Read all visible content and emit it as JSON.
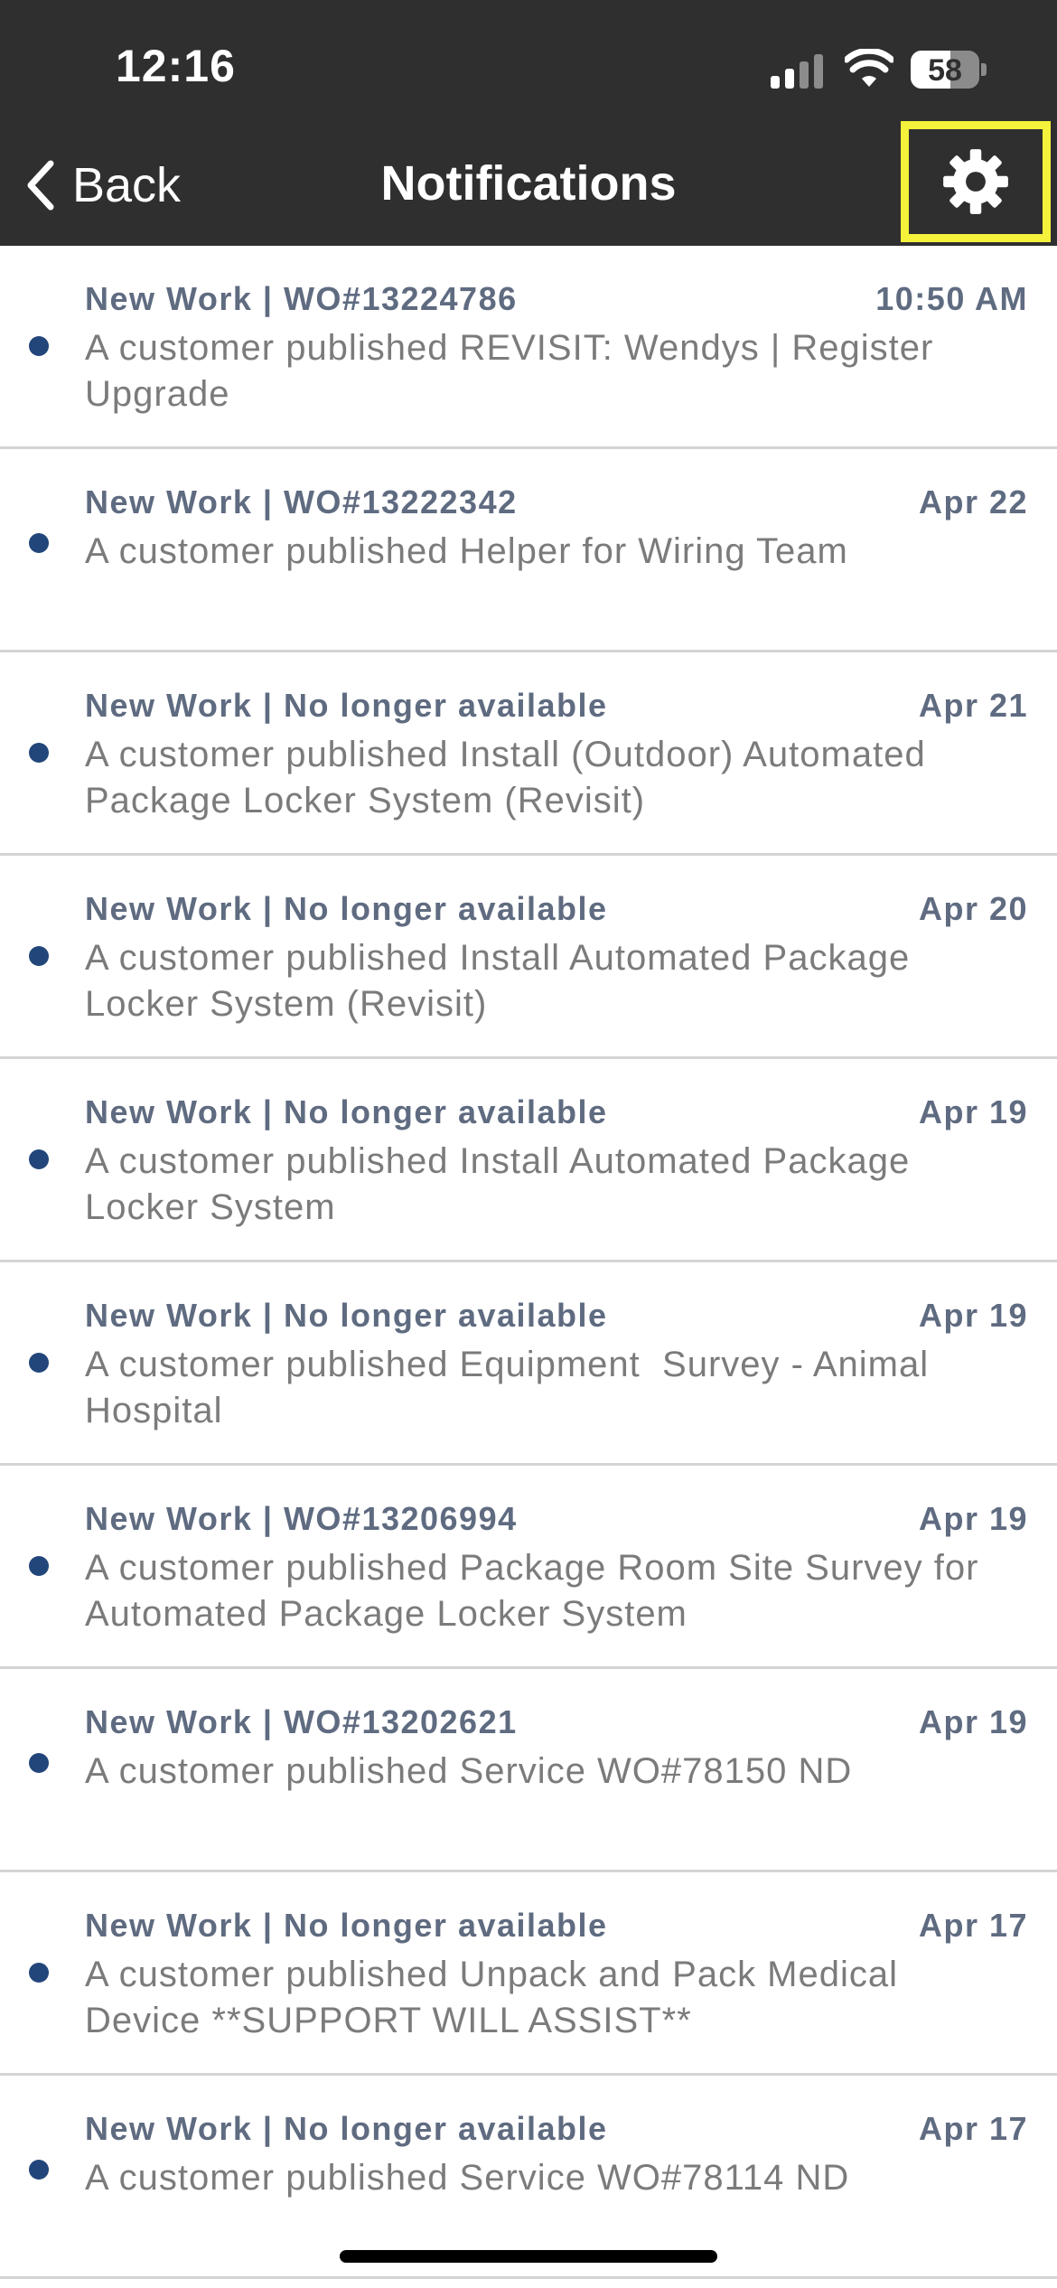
{
  "status_bar": {
    "time": "12:16",
    "battery_percent": "58",
    "battery_level": 0.58
  },
  "nav": {
    "back_label": "Back",
    "title": "Notifications",
    "settings_icon": "gear-icon",
    "highlight_color": "#f4f23a"
  },
  "notifications": [
    {
      "header": "New Work | WO#13224786",
      "time": "10:50 AM",
      "text": "A customer published REVISIT: Wendys | Register Upgrade"
    },
    {
      "header": "New Work | WO#13222342",
      "time": "Apr 22",
      "text": "A customer published Helper for Wiring Team"
    },
    {
      "header": "New Work | No longer available",
      "time": "Apr 21",
      "text": "A customer published Install (Outdoor) Automated Package Locker System (Revisit)"
    },
    {
      "header": "New Work | No longer available",
      "time": "Apr 20",
      "text": "A customer published Install Automated Package Locker System (Revisit)"
    },
    {
      "header": "New Work | No longer available",
      "time": "Apr 19",
      "text": "A customer published Install Automated Package Locker System"
    },
    {
      "header": "New Work | No longer available",
      "time": "Apr 19",
      "text": "A customer published Equipment  Survey - Animal Hospital"
    },
    {
      "header": "New Work | WO#13206994",
      "time": "Apr 19",
      "text": "A customer published Package Room Site Survey for Automated Package Locker System"
    },
    {
      "header": "New Work | WO#13202621",
      "time": "Apr 19",
      "text": "A customer published Service WO#78150 ND"
    },
    {
      "header": "New Work | No longer available",
      "time": "Apr 17",
      "text": "A customer published Unpack and Pack Medical Device **SUPPORT WILL ASSIST**"
    },
    {
      "header": "New Work | No longer available",
      "time": "Apr 17",
      "text": "A customer published Service WO#78114 ND"
    }
  ],
  "colors": {
    "header_bg": "#2f2f2f",
    "unread_dot": "#22467a",
    "item_header_text": "#5f6b80",
    "item_body_text": "#7b7b7b"
  }
}
